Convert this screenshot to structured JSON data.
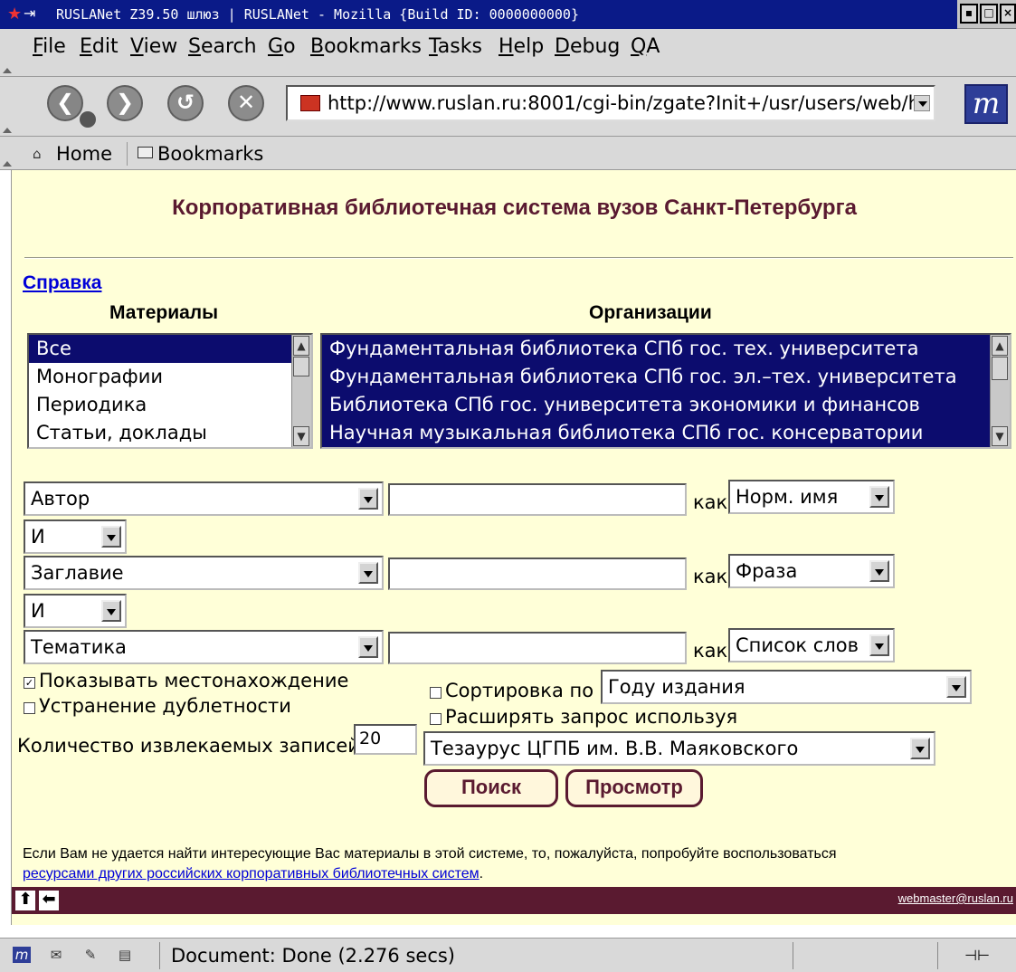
{
  "window": {
    "title": "RUSLANet Z39.50 шлюз | RUSLANet - Mozilla {Build ID: 0000000000}"
  },
  "menubar": {
    "items": [
      {
        "ul": "F",
        "rest": "ile"
      },
      {
        "ul": "E",
        "rest": "dit"
      },
      {
        "ul": "V",
        "rest": "iew"
      },
      {
        "ul": "S",
        "rest": "earch"
      },
      {
        "ul": "G",
        "rest": "o"
      },
      {
        "ul": "B",
        "rest": "ookmarks"
      },
      {
        "ul": "T",
        "rest": "asks"
      },
      {
        "ul": "H",
        "rest": "elp"
      },
      {
        "ul": "D",
        "rest": "ebug"
      },
      {
        "ul": "Q",
        "rest": "A"
      }
    ]
  },
  "navbar": {
    "url": "http://www.ruslan.ru:8001/cgi-bin/zgate?Init+/usr/users/web/h"
  },
  "personal": {
    "home": "Home",
    "bookmarks": "Bookmarks"
  },
  "page": {
    "title": "Корпоративная библиотечная система вузов Санкт-Петербурга",
    "help_link": "Справка",
    "materials_head": "Материалы",
    "orgs_head": "Организации",
    "materials": [
      "Все",
      "Монографии",
      "Периодика",
      "Статьи, доклады"
    ],
    "orgs": [
      "Фундаментальная библиотека СПб гос. тех. университета",
      "Фундаментальная библиотека СПб гос. эл.–тех. университета",
      "Библиотека СПб гос. университета экономики и финансов",
      "Научная музыкальная библиотека СПб гос. консерватории"
    ],
    "kak": "как",
    "rows": [
      {
        "field": "Автор",
        "value": "",
        "mode": "Норм. имя",
        "op": "И"
      },
      {
        "field": "Заглавие",
        "value": "",
        "mode": "Фраза",
        "op": "И"
      },
      {
        "field": "Тематика",
        "value": "",
        "mode": "Список слов"
      }
    ],
    "show_location": "Показывать местонахождение",
    "dedup": "Устранение дублетности",
    "count_label": "Количество извлекаемых записей",
    "count_value": "20",
    "sort_label": "Сортировка по",
    "sort_value": "Году издания",
    "expand_label": "Расширять запрос используя",
    "thesaurus": "Тезаурус ЦГПБ им. В.В. Маяковского",
    "search_btn": "Поиск",
    "browse_btn": "Просмотр",
    "note_text": "Если Вам не удается найти интересующие Вас материалы в этой системе, то, пожалуйста, попробуйте воспользоваться",
    "note_link": "ресурсами других российских корпоративных библиотечных систем",
    "note_end": ".",
    "webmaster": "webmaster@ruslan.ru"
  },
  "status": {
    "text": "Document: Done (2.276 secs)"
  }
}
